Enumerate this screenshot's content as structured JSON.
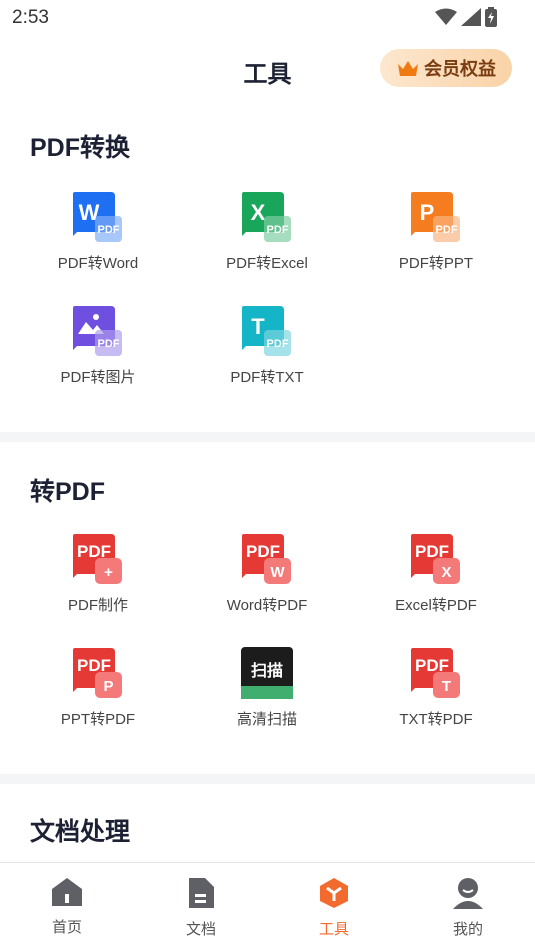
{
  "status": {
    "time": "2:53"
  },
  "header": {
    "title": "工具",
    "vip_label": "会员权益"
  },
  "sections": [
    {
      "title": "PDF转换",
      "tools": [
        {
          "label": "PDF转Word",
          "letter": "W",
          "badge": "PDF",
          "color": "#1f6ff2"
        },
        {
          "label": "PDF转Excel",
          "letter": "X",
          "badge": "PDF",
          "color": "#1aa65a"
        },
        {
          "label": "PDF转PPT",
          "letter": "P",
          "badge": "PDF",
          "color": "#f57c1f"
        },
        {
          "label": "PDF转图片",
          "letter": "",
          "badge": "PDF",
          "color": "#6e4fe0"
        },
        {
          "label": "PDF转TXT",
          "letter": "T",
          "badge": "PDF",
          "color": "#15b5c8"
        }
      ]
    },
    {
      "title": "转PDF",
      "tools": [
        {
          "label": "PDF制作",
          "letter": "PDF",
          "badge": "+",
          "color": "#e53935"
        },
        {
          "label": "Word转PDF",
          "letter": "PDF",
          "badge": "W",
          "color": "#e53935"
        },
        {
          "label": "Excel转PDF",
          "letter": "PDF",
          "badge": "X",
          "color": "#e53935"
        },
        {
          "label": "PPT转PDF",
          "letter": "PDF",
          "badge": "P",
          "color": "#e53935"
        },
        {
          "label": "高清扫描",
          "letter": "扫描",
          "badge": "",
          "color": "#1c1c1c"
        },
        {
          "label": "TXT转PDF",
          "letter": "PDF",
          "badge": "T",
          "color": "#e53935"
        }
      ]
    },
    {
      "title": "文档处理"
    }
  ],
  "nav": [
    {
      "label": "首页",
      "icon": "home-icon"
    },
    {
      "label": "文档",
      "icon": "document-icon"
    },
    {
      "label": "工具",
      "icon": "tools-icon",
      "active": true
    },
    {
      "label": "我的",
      "icon": "profile-icon"
    }
  ],
  "colors": {
    "accent": "#f26a2e",
    "vip_text": "#7a3d12"
  }
}
